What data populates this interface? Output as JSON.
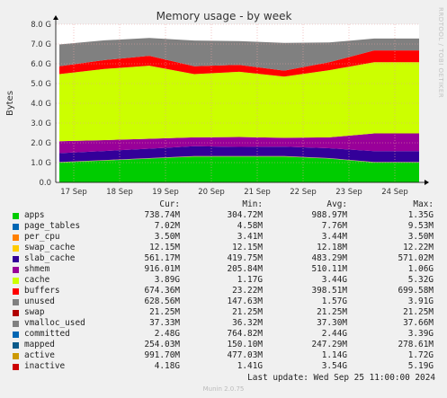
{
  "chart_data": {
    "type": "area",
    "title": "Memory usage - by week",
    "ylabel": "Bytes",
    "ylim": [
      0,
      8.0
    ],
    "y_unit": "G",
    "yticks": [
      "0.0",
      "1.0 G",
      "2.0 G",
      "3.0 G",
      "4.0 G",
      "5.0 G",
      "6.0 G",
      "7.0 G",
      "8.0 G"
    ],
    "categories": [
      "17 Sep",
      "18 Sep",
      "19 Sep",
      "20 Sep",
      "21 Sep",
      "22 Sep",
      "23 Sep",
      "24 Sep"
    ],
    "series": [
      {
        "name": "apps",
        "color": "#00cc00",
        "values": [
          1.0,
          1.1,
          1.2,
          1.3,
          1.3,
          1.3,
          1.2,
          1.0
        ]
      },
      {
        "name": "page_tables",
        "color": "#0066b3",
        "values": [
          0.01,
          0.01,
          0.01,
          0.01,
          0.01,
          0.01,
          0.01,
          0.01
        ]
      },
      {
        "name": "per_cpu",
        "color": "#ff8000",
        "values": [
          0.0035,
          0.0035,
          0.0035,
          0.0035,
          0.0035,
          0.0035,
          0.0035,
          0.0035
        ]
      },
      {
        "name": "swap_cache",
        "color": "#ffcc00",
        "values": [
          0.012,
          0.012,
          0.012,
          0.012,
          0.012,
          0.012,
          0.012,
          0.012
        ]
      },
      {
        "name": "slab_cache",
        "color": "#330099",
        "values": [
          0.45,
          0.46,
          0.48,
          0.5,
          0.47,
          0.48,
          0.5,
          0.55
        ]
      },
      {
        "name": "shmem",
        "color": "#990099",
        "values": [
          0.6,
          0.55,
          0.5,
          0.45,
          0.5,
          0.45,
          0.55,
          0.9
        ]
      },
      {
        "name": "cache",
        "color": "#ccff00",
        "values": [
          3.4,
          3.6,
          3.7,
          3.2,
          3.3,
          3.1,
          3.4,
          3.6
        ]
      },
      {
        "name": "buffers",
        "color": "#ff0000",
        "values": [
          0.4,
          0.45,
          0.5,
          0.4,
          0.35,
          0.3,
          0.4,
          0.6
        ]
      },
      {
        "name": "unused",
        "color": "#808080",
        "values": [
          1.1,
          1.0,
          0.9,
          1.3,
          1.2,
          1.4,
          1.0,
          0.6
        ]
      }
    ],
    "legend_columns": [
      "Cur:",
      "Min:",
      "Avg:",
      "Max:"
    ],
    "legend_table": [
      {
        "name": "apps",
        "color": "#00cc00",
        "cur": "738.74M",
        "min": "304.72M",
        "avg": "988.97M",
        "max": "1.35G"
      },
      {
        "name": "page_tables",
        "color": "#0066b3",
        "cur": "7.02M",
        "min": "4.58M",
        "avg": "7.76M",
        "max": "9.53M"
      },
      {
        "name": "per_cpu",
        "color": "#ff8000",
        "cur": "3.50M",
        "min": "3.41M",
        "avg": "3.44M",
        "max": "3.50M"
      },
      {
        "name": "swap_cache",
        "color": "#ffcc00",
        "cur": "12.15M",
        "min": "12.15M",
        "avg": "12.18M",
        "max": "12.22M"
      },
      {
        "name": "slab_cache",
        "color": "#330099",
        "cur": "561.17M",
        "min": "419.75M",
        "avg": "483.29M",
        "max": "571.02M"
      },
      {
        "name": "shmem",
        "color": "#990099",
        "cur": "916.01M",
        "min": "205.84M",
        "avg": "510.11M",
        "max": "1.06G"
      },
      {
        "name": "cache",
        "color": "#ccff00",
        "cur": "3.89G",
        "min": "1.17G",
        "avg": "3.44G",
        "max": "5.32G"
      },
      {
        "name": "buffers",
        "color": "#ff0000",
        "cur": "674.36M",
        "min": "23.22M",
        "avg": "398.51M",
        "max": "699.58M"
      },
      {
        "name": "unused",
        "color": "#808080",
        "cur": "628.56M",
        "min": "147.63M",
        "avg": "1.57G",
        "max": "3.91G"
      },
      {
        "name": "swap",
        "color": "#b00000",
        "cur": "21.25M",
        "min": "21.25M",
        "avg": "21.25M",
        "max": "21.25M"
      },
      {
        "name": "vmalloc_used",
        "color": "#808080",
        "cur": "37.33M",
        "min": "36.32M",
        "avg": "37.30M",
        "max": "37.66M"
      },
      {
        "name": "committed",
        "color": "#0066b3",
        "cur": "2.48G",
        "min": "764.82M",
        "avg": "2.44G",
        "max": "3.39G"
      },
      {
        "name": "mapped",
        "color": "#0a5a8a",
        "cur": "254.03M",
        "min": "150.10M",
        "avg": "247.29M",
        "max": "278.61M"
      },
      {
        "name": "active",
        "color": "#cc9900",
        "cur": "991.70M",
        "min": "477.03M",
        "avg": "1.14G",
        "max": "1.72G"
      },
      {
        "name": "inactive",
        "color": "#cc0000",
        "cur": "4.18G",
        "min": "1.41G",
        "avg": "3.54G",
        "max": "5.19G"
      }
    ],
    "last_update": "Last update: Wed Sep 25 11:00:00 2024",
    "grid": true,
    "legend_position": "bottom"
  },
  "footer": {
    "munin": "Munin 2.0.75",
    "side_label": "RRDTOOL / TOBI OETIKER"
  }
}
